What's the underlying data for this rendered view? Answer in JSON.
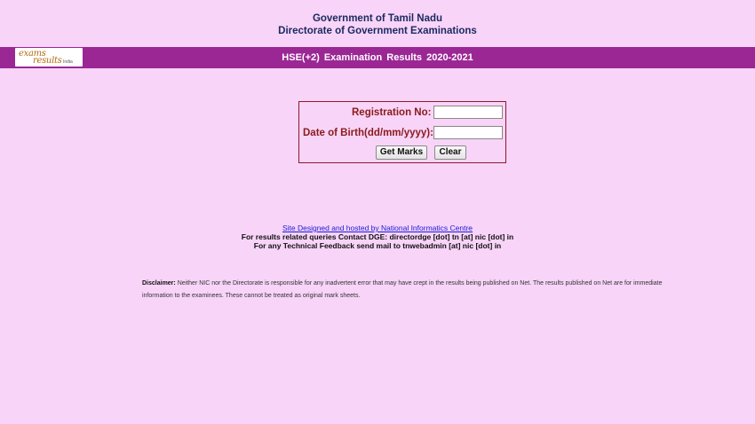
{
  "header": {
    "line1": "Government of Tamil Nadu",
    "line2": "Directorate of Government Examinations"
  },
  "banner": {
    "logo_line1": "exams",
    "logo_line2": "results",
    "logo_tag": "India",
    "title": "HSE(+2)  Examination Results  2020-2021"
  },
  "form": {
    "reg_label": "Registration No:",
    "reg_value": "",
    "dob_label": "Date of Birth(dd/mm/yyyy):",
    "dob_value": "",
    "get_marks_label": "Get Marks",
    "clear_label": "Clear"
  },
  "footer": {
    "link_text": "Site Designed and hosted by National Informatics Centre",
    "contact_line": "For results related queries Contact DGE:  directordge [dot] tn [at] nic [dot] in",
    "feedback_line": "For any Technical Feedback send mail to tnwebadmin [at] nic [dot] in"
  },
  "disclaimer": {
    "label": "Disclaimer:",
    "text": "Neither NIC nor the Directorate is responsible for any inadvertent error that may have crept in the results being published on Net. The results published on Net are for immediate information to the examinees. These cannot be treated as original mark sheets."
  },
  "colors": {
    "background": "#f8d4f8",
    "banner": "#9b2795",
    "label": "#8b1a1a",
    "heading": "#1a2a5e"
  }
}
